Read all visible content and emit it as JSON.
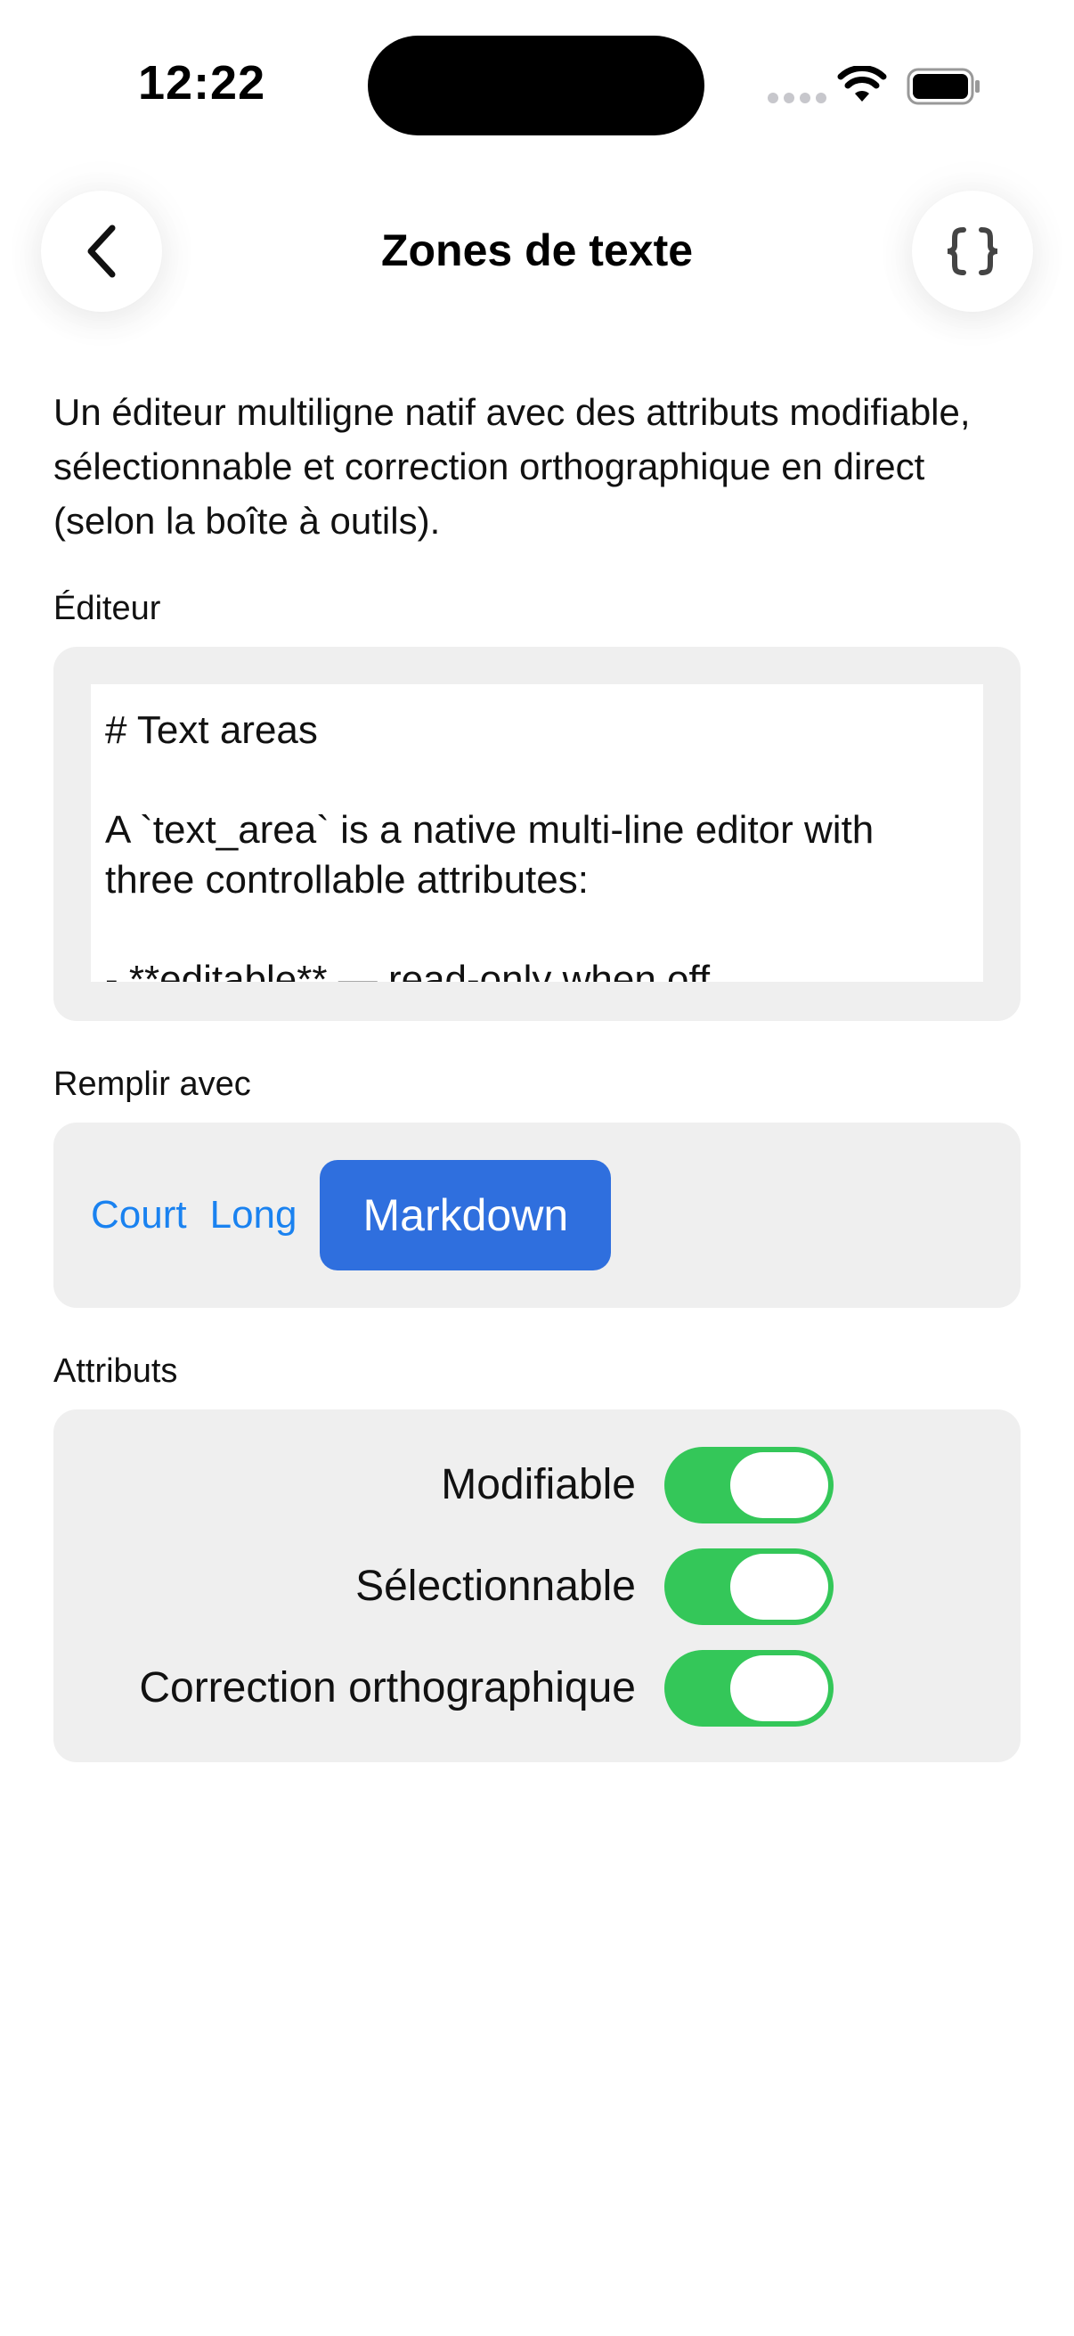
{
  "status_bar": {
    "time": "12:22"
  },
  "header": {
    "title": "Zones de texte",
    "back_icon": "chevron-left-icon",
    "code_icon": "curly-braces-icon"
  },
  "description": "Un éditeur multiligne natif avec des attributs modifiable, sélectionnable et correction orthographique en direct (selon la boîte à outils).",
  "editor_section": {
    "label": "Éditeur",
    "content": "# Text areas\n\nA `text_area` is a native multi-line editor with three controllable attributes:\n\n- **editable** — read-only when off"
  },
  "fill_section": {
    "label": "Remplir avec",
    "buttons": [
      "Court",
      "Long",
      "Markdown"
    ],
    "selected": "Markdown"
  },
  "attributes_section": {
    "label": "Attributs",
    "toggles": [
      {
        "label": "Modifiable",
        "on": true
      },
      {
        "label": "Sélectionnable",
        "on": true
      },
      {
        "label": "Correction orthographique",
        "on": true
      }
    ]
  },
  "colors": {
    "accent": "#2f6fde",
    "link": "#1a82f0",
    "toggle_on": "#34c759",
    "card_bg": "#efefef"
  }
}
